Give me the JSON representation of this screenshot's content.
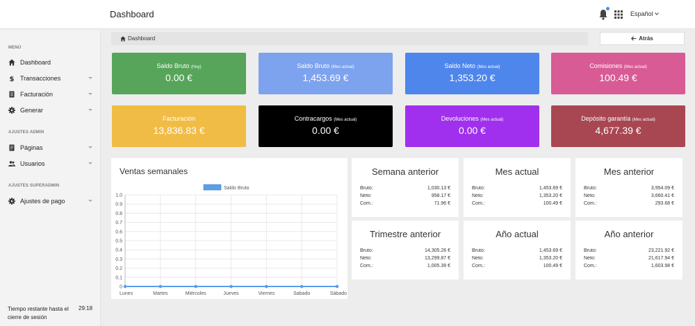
{
  "header": {
    "title": "Dashboard",
    "language": "Español"
  },
  "sidebar": {
    "menu_title": "MENÚ",
    "admin_title": "AJUSTES ADMIN",
    "superadmin_title": "AJUSTES SUPERADMIN",
    "items": [
      {
        "label": "Dashboard",
        "icon": "home-icon"
      },
      {
        "label": "Transacciones",
        "icon": "dollar-icon"
      },
      {
        "label": "Facturación",
        "icon": "receipt-icon"
      },
      {
        "label": "Generar",
        "icon": "gear-icon"
      },
      {
        "label": "Páginas",
        "icon": "page-icon"
      },
      {
        "label": "Usuarios",
        "icon": "users-icon"
      },
      {
        "label": "Ajustes de pago",
        "icon": "gear-icon"
      }
    ],
    "session_label": "Tiempo restante hasta el cierre de sesión",
    "session_time": "29:18"
  },
  "breadcrumb": {
    "label": "Dashboard"
  },
  "back_button": {
    "label": "Atrás"
  },
  "stats": [
    {
      "title": "Saldo Bruto",
      "note": "(Hoy)",
      "value": "0.00 €",
      "color": "#56a55a"
    },
    {
      "title": "Saldo Bruto",
      "note": "(Mes actual)",
      "value": "1,453.69 €",
      "color": "#7da2ee"
    },
    {
      "title": "Saldo Neto",
      "note": "(Mes actual)",
      "value": "1,353.20 €",
      "color": "#4f86ec"
    },
    {
      "title": "Comisiones",
      "note": "(Mes actual)",
      "value": "100.49 €",
      "color": "#d95b96"
    },
    {
      "title": "Facturación",
      "note": "",
      "value": "13,836.83 €",
      "color": "#f0bc45"
    },
    {
      "title": "Contracargos",
      "note": "(Mes actual)",
      "value": "0.00 €",
      "color": "#000000"
    },
    {
      "title": "Devoluciones",
      "note": "(Mes actual)",
      "value": "0.00 €",
      "color": "#a030ed"
    },
    {
      "title": "Depósito garantía",
      "note": "(Mes actual)",
      "value": "4,677.39 €",
      "color": "#a84752"
    }
  ],
  "chart": {
    "title": "Ventas semanales"
  },
  "chart_data": {
    "type": "line",
    "categories": [
      "Lunes",
      "Martes",
      "Miércoles",
      "Jueves",
      "Viernes",
      "Sabado",
      "Sábado"
    ],
    "series": [
      {
        "name": "Saldo Bruto",
        "values": [
          0,
          0,
          0,
          0,
          0,
          0,
          0
        ],
        "color": "#5a9ee8"
      }
    ],
    "yticks": [
      "1.0",
      "0.9",
      "0.8",
      "0.7",
      "0.6",
      "0.5",
      "0.4",
      "0.3",
      "0.2",
      "0.1",
      "0"
    ],
    "ylim": [
      0,
      1
    ],
    "grid": true,
    "legend": "top"
  },
  "summaries": [
    {
      "title": "Semana anterior",
      "bruto": "1,030.13 €",
      "neto": "958.17 €",
      "com": "71.96 €"
    },
    {
      "title": "Mes actual",
      "bruto": "1,453.69 €",
      "neto": "1,353.20 €",
      "com": "100.49 €"
    },
    {
      "title": "Mes anterior",
      "bruto": "3,954.09 €",
      "neto": "3,660.41 €",
      "com": "293.68 €"
    },
    {
      "title": "Trimestre anterior",
      "bruto": "14,305.26 €",
      "neto": "13,299.87 €",
      "com": "1,005.39 €"
    },
    {
      "title": "Año actual",
      "bruto": "1,453.69 €",
      "neto": "1,353.20 €",
      "com": "100.49 €"
    },
    {
      "title": "Año anterior",
      "bruto": "23,221.92 €",
      "neto": "21,617.94 €",
      "com": "1,603.98 €"
    }
  ],
  "summary_labels": {
    "bruto": "Bruto:",
    "neto": "Neto:",
    "com": "Com.:"
  }
}
